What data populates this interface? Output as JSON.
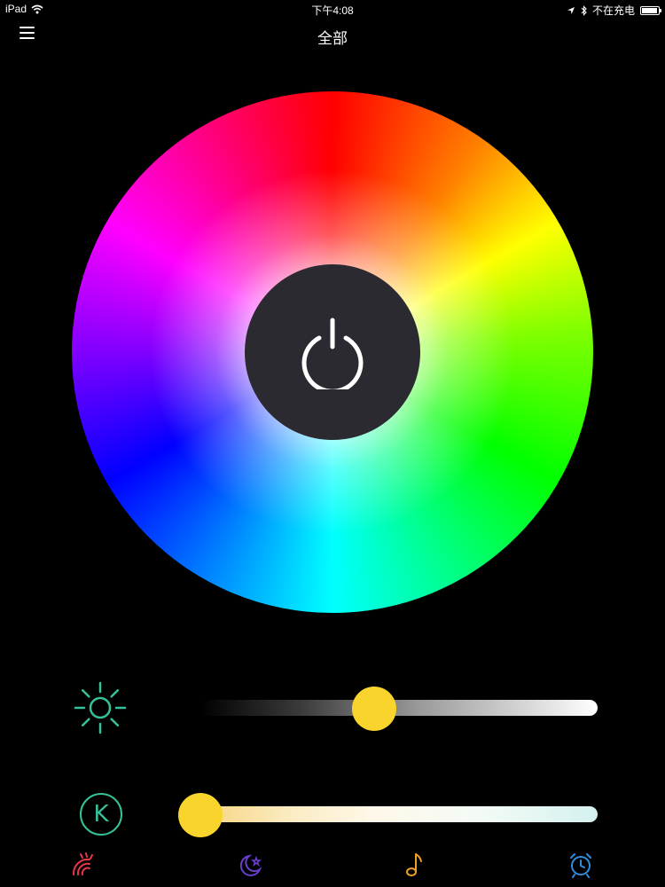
{
  "status_bar": {
    "device": "iPad",
    "time": "下午4:08",
    "charging": "不在充电",
    "battery_level": 0.95
  },
  "nav": {
    "title": "全部",
    "menu_icon": "hamburger-menu-icon"
  },
  "wheel": {
    "power_icon": "power-icon"
  },
  "brightness": {
    "icon": "sun-icon",
    "value": 0.44,
    "thumb_color": "#f9d42c"
  },
  "color_temperature": {
    "icon_letter": "K",
    "value": 0.0,
    "accent": "#35c29a"
  },
  "tabs": [
    {
      "icon": "rainbow-icon",
      "color": "#e8364a"
    },
    {
      "icon": "moon-stars-icon",
      "color": "#6a3fd0"
    },
    {
      "icon": "music-note-icon",
      "color": "#f0a020"
    },
    {
      "icon": "alarm-clock-icon",
      "color": "#2f8de0"
    }
  ]
}
